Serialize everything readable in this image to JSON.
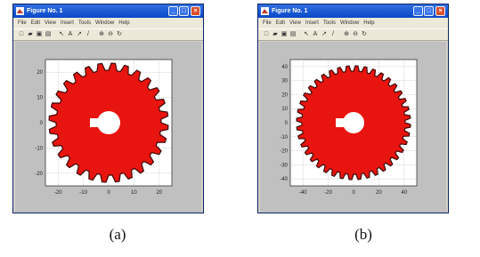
{
  "windows": [
    {
      "title": "Figure No. 1",
      "menu": [
        "File",
        "Edit",
        "View",
        "Insert",
        "Tools",
        "Window",
        "Help"
      ],
      "x_ticks": [
        "-20",
        "-10",
        "0",
        "10",
        "20"
      ],
      "y_ticks": [
        "20",
        "10",
        "0",
        "-10",
        "-20"
      ],
      "teeth": 28,
      "caption": "(a)"
    },
    {
      "title": "Figure No. 1",
      "menu": [
        "File",
        "Edit",
        "View",
        "Insert",
        "Tools",
        "Window",
        "Help"
      ],
      "x_ticks": [
        "-40",
        "-20",
        "0",
        "20",
        "40"
      ],
      "y_ticks": [
        "40",
        "30",
        "20",
        "10",
        "0",
        "-10",
        "-20",
        "-30",
        "-40"
      ],
      "teeth": 40,
      "caption": "(b)"
    }
  ],
  "colors": {
    "gear": "#e8140f",
    "gear_edge": "#3a0a08",
    "hole": "#ffffff",
    "axes_bg": "#ffffff",
    "grid": "#9a9a9a"
  },
  "icons": [
    "new-file-icon",
    "open-icon",
    "save-icon",
    "print-icon",
    "arrow-icon",
    "text-icon",
    "arrow-draw-icon",
    "line-icon",
    "zoom-in-icon",
    "zoom-out-icon",
    "rotate-icon"
  ]
}
